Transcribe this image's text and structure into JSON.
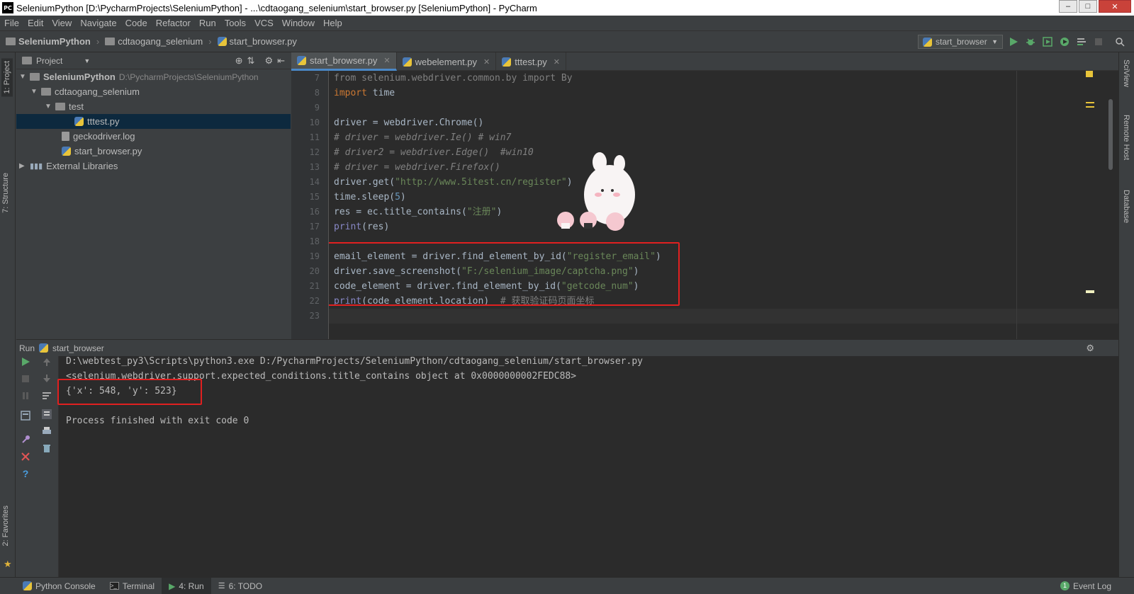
{
  "window": {
    "title": "SeleniumPython [D:\\PycharmProjects\\SeleniumPython] - ...\\cdtaogang_selenium\\start_browser.py [SeleniumPython] - PyCharm",
    "logo_text": "PC"
  },
  "menu": [
    "File",
    "Edit",
    "View",
    "Navigate",
    "Code",
    "Refactor",
    "Run",
    "Tools",
    "VCS",
    "Window",
    "Help"
  ],
  "breadcrumb": {
    "project": "SeleniumPython",
    "folder": "cdtaogang_selenium",
    "file": "start_browser.py"
  },
  "run_config": {
    "selected": "start_browser"
  },
  "left_stripe": {
    "project_tab": "1: Project",
    "structure_tab": "7: Structure",
    "favorites_tab": "2: Favorites"
  },
  "right_stripe": {
    "sciview": "SciView",
    "remote_host": "Remote Host",
    "database": "Database"
  },
  "project_panel": {
    "title": "Project",
    "tree": {
      "root_name": "SeleniumPython",
      "root_path": "D:\\PycharmProjects\\SeleniumPython",
      "folder1": "cdtaogang_selenium",
      "folder2": "test",
      "file_selected": "tttest.py",
      "file2": "geckodriver.log",
      "file3": "start_browser.py",
      "external": "External Libraries"
    }
  },
  "editor": {
    "tabs": [
      "start_browser.py",
      "webelement.py",
      "tttest.py"
    ],
    "line_numbers": [
      "7",
      "8",
      "9",
      "10",
      "11",
      "12",
      "13",
      "14",
      "15",
      "16",
      "17",
      "18",
      "19",
      "20",
      "21",
      "22",
      "23"
    ],
    "lines": {
      "l7": "from selenium.webdriver.common.by import By",
      "l8_kw": "import",
      "l8_rest": " time",
      "l10": "driver = webdriver.Chrome()",
      "l11": "# driver = webdriver.Ie() # win7",
      "l12": "# driver2 = webdriver.Edge()  #win10",
      "l13": "# driver = webdriver.Firefox()",
      "l14_a": "driver.get(",
      "l14_s": "\"http://www.5itest.cn/register\"",
      "l14_b": ")",
      "l15_a": "time.sleep(",
      "l15_n": "5",
      "l15_b": ")",
      "l16_a": "res = ec.title_contains(",
      "l16_s": "\"注册\"",
      "l16_b": ")",
      "l17_p": "print",
      "l17_b": "(res)",
      "l19_a": "email_element = driver.find_element_by_id(",
      "l19_s": "\"register_email\"",
      "l19_b": ")",
      "l20_a": "driver.save_screenshot(",
      "l20_s": "\"F:/selenium_image/captcha.png\"",
      "l20_b": ")",
      "l21_a": "code_element = driver.find_element_by_id(",
      "l21_s": "\"getcode_num\"",
      "l21_b": ")",
      "l22_p": "print",
      "l22_b": "(code_element.location)  ",
      "l22_c": "# 获取验证码页面坐标"
    }
  },
  "run_panel": {
    "label": "Run",
    "config": "start_browser",
    "output": [
      "D:\\webtest_py3\\Scripts\\python3.exe D:/PycharmProjects/SeleniumPython/cdtaogang_selenium/start_browser.py",
      "<selenium.webdriver.support.expected_conditions.title_contains object at 0x0000000002FEDC88>",
      "{'x': 548, 'y': 523}",
      "",
      "Process finished with exit code 0"
    ]
  },
  "status_bar": {
    "python_console": "Python Console",
    "terminal": "Terminal",
    "run": "4: Run",
    "todo": "6: TODO",
    "event_log": "Event Log"
  },
  "colors": {
    "highlight_box": "#e02020",
    "run_green": "#59a869",
    "selection": "#0d293e"
  }
}
